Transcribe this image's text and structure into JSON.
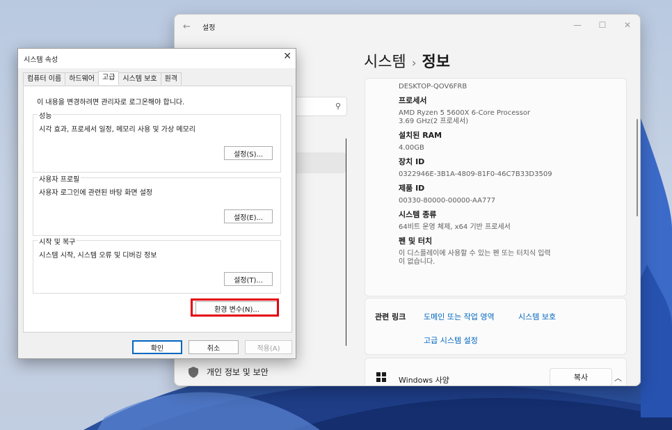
{
  "settings": {
    "window_title": "설정",
    "breadcrumb_parent": "시스템",
    "breadcrumb_sep": "›",
    "breadcrumb_current": "정보",
    "nav_privacy": "개인 정보 및 보안",
    "specs": {
      "device_name": "DESKTOP-QOV6FRB",
      "processor_label": "프로세서",
      "processor_value_line1": "AMD Ryzen 5 5600X 6-Core Processor",
      "processor_value_line2": "3.69 GHz(2 프로세서)",
      "ram_label": "설치된 RAM",
      "ram_value": "4.00GB",
      "device_id_label": "장치 ID",
      "device_id_value": "0322946E-3B1A-4809-81F0-46C7B33D3509",
      "product_id_label": "제품 ID",
      "product_id_value": "00330-80000-00000-AA777",
      "system_type_label": "시스템 종류",
      "system_type_value": "64비트 운영 체제, x64 기반 프로세서",
      "pen_touch_label": "펜 및 터치",
      "pen_touch_value_line1": "이 디스플레이에 사용할 수 있는 펜 또는 터치식 입력",
      "pen_touch_value_line2": "이 없습니다."
    },
    "related_links_label": "관련 링크",
    "link_domain": "도메인 또는 작업 영역",
    "link_protection": "시스템 보호",
    "link_advanced": "고급 시스템 설정",
    "windows_spec_label": "Windows 사양",
    "copy_button": "복사"
  },
  "dialog": {
    "title": "시스템 속성",
    "tabs": [
      "컴퓨터 이름",
      "하드웨어",
      "고급",
      "시스템 보호",
      "원격"
    ],
    "active_tab": "고급",
    "note": "이 내용을 변경하려면 관리자로 로그온해야 합니다.",
    "performance": {
      "title": "성능",
      "desc": "시각 효과, 프로세서 일정, 메모리 사용 및 가상 메모리",
      "button": "설정(S)..."
    },
    "profile": {
      "title": "사용자 프로필",
      "desc": "사용자 로그인에 관련된 바탕 화면 설정",
      "button": "설정(E)..."
    },
    "startup": {
      "title": "시작 및 복구",
      "desc": "시스템 시작, 시스템 오류 및 디버깅 정보",
      "button": "설정(T)..."
    },
    "env_button": "환경 변수(N)...",
    "ok": "확인",
    "cancel": "취소",
    "apply": "적용(A)"
  },
  "colors": {
    "highlight": "#e5000b",
    "link": "#0067c0",
    "accent": "#0067c0"
  }
}
